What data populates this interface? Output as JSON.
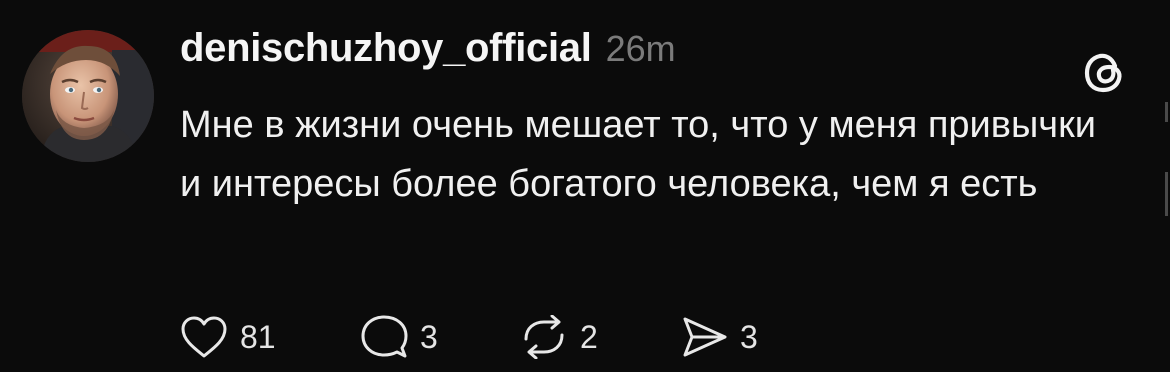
{
  "post": {
    "username": "denischuzhoy_official",
    "timestamp": "26m",
    "text": "Мне в жизни очень мешает то, что у меня привычки и интересы более богатого человека, чем я есть",
    "avatar_icon": "profile-photo",
    "app_logo_icon": "threads-logo-icon"
  },
  "actions": {
    "like": {
      "icon": "heart-icon",
      "count": "81"
    },
    "reply": {
      "icon": "comment-bubble-icon",
      "count": "3"
    },
    "repost": {
      "icon": "repost-icon",
      "count": "2"
    },
    "share": {
      "icon": "send-icon",
      "count": "3"
    }
  },
  "colors": {
    "background": "#0b0b0b",
    "text": "#f0f0f0",
    "muted": "#7b7b7b"
  }
}
